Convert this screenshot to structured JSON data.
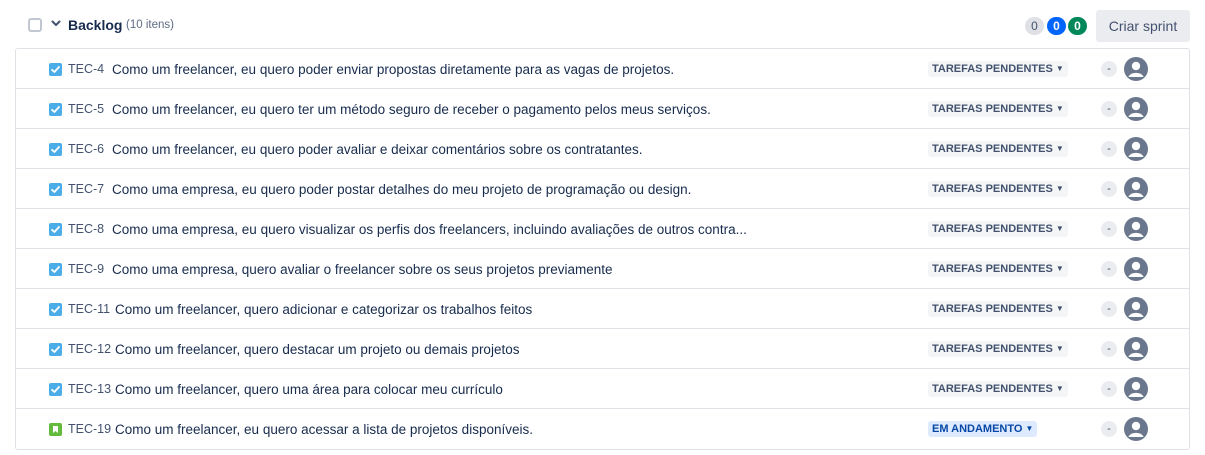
{
  "backlog": {
    "title": "Backlog",
    "count_label": "(10 itens)",
    "counts": {
      "todo": "0",
      "in_progress": "0",
      "done": "0"
    },
    "create_sprint_label": "Criar sprint"
  },
  "issue_types": {
    "story": {
      "color": "#4bade8",
      "icon": "checkbox-icon"
    },
    "bookmark": {
      "color": "#63ba3c",
      "icon": "bookmark-icon"
    }
  },
  "issues": [
    {
      "key": "TEC-4",
      "type": "story",
      "summary": "Como um freelancer, eu quero poder enviar propostas diretamente para as vagas de projetos.",
      "status": "TAREFAS PENDENTES",
      "status_kind": "todo",
      "estimate": "-"
    },
    {
      "key": "TEC-5",
      "type": "story",
      "summary": "Como um freelancer, eu quero ter um método seguro de receber o pagamento pelos meus serviços.",
      "status": "TAREFAS PENDENTES",
      "status_kind": "todo",
      "estimate": "-"
    },
    {
      "key": "TEC-6",
      "type": "story",
      "summary": "Como um freelancer, eu quero poder avaliar e deixar comentários sobre os contratantes.",
      "status": "TAREFAS PENDENTES",
      "status_kind": "todo",
      "estimate": "-"
    },
    {
      "key": "TEC-7",
      "type": "story",
      "summary": "Como uma empresa, eu quero poder postar detalhes do meu projeto de programação ou design.",
      "status": "TAREFAS PENDENTES",
      "status_kind": "todo",
      "estimate": "-"
    },
    {
      "key": "TEC-8",
      "type": "story",
      "summary": "Como uma empresa, eu quero visualizar os perfis dos freelancers, incluindo avaliações de outros contra...",
      "status": "TAREFAS PENDENTES",
      "status_kind": "todo",
      "estimate": "-"
    },
    {
      "key": "TEC-9",
      "type": "story",
      "summary": "Como uma empresa, quero avaliar o freelancer sobre os seus projetos previamente",
      "status": "TAREFAS PENDENTES",
      "status_kind": "todo",
      "estimate": "-"
    },
    {
      "key": "TEC-11",
      "type": "story",
      "summary": "Como um freelancer, quero adicionar e categorizar os trabalhos feitos",
      "status": "TAREFAS PENDENTES",
      "status_kind": "todo",
      "estimate": "-"
    },
    {
      "key": "TEC-12",
      "type": "story",
      "summary": "Como um freelancer, quero destacar um projeto ou demais projetos",
      "status": "TAREFAS PENDENTES",
      "status_kind": "todo",
      "estimate": "-"
    },
    {
      "key": "TEC-13",
      "type": "story",
      "summary": "Como um freelancer, quero uma área para colocar meu currículo",
      "status": "TAREFAS PENDENTES",
      "status_kind": "todo",
      "estimate": "-"
    },
    {
      "key": "TEC-19",
      "type": "bookmark",
      "summary": "Como um freelancer, eu quero acessar a lista de projetos disponíveis.",
      "status": "EM ANDAMENTO",
      "status_kind": "inprog",
      "estimate": "-"
    }
  ]
}
